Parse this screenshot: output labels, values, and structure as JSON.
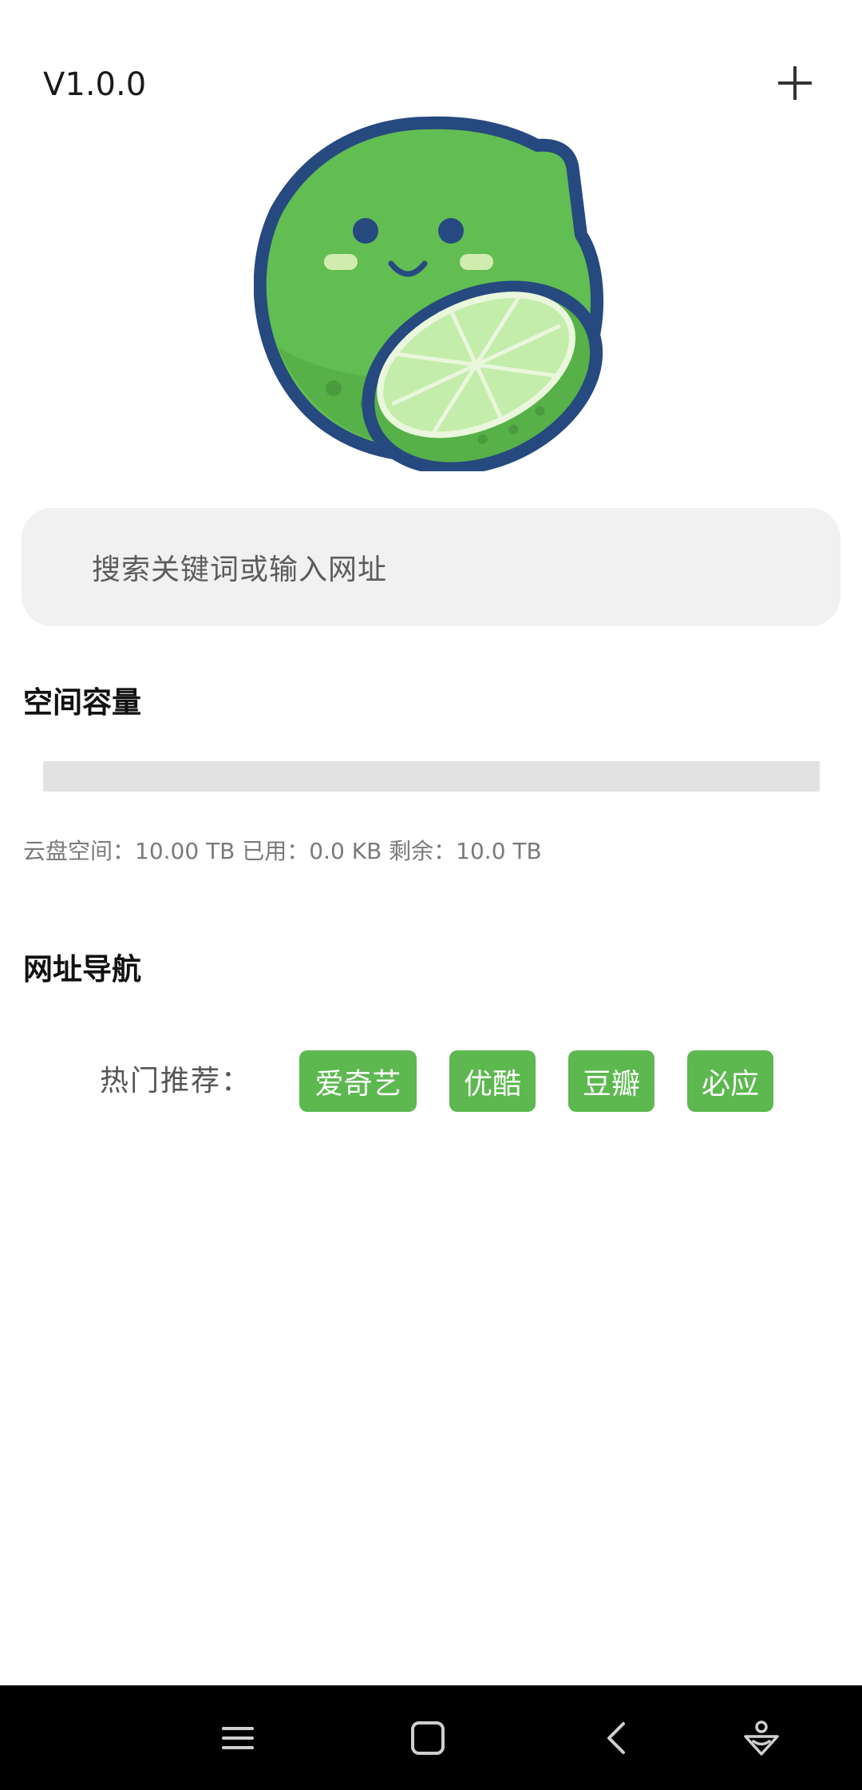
{
  "header": {
    "version": "V1.0.0",
    "add_icon": "plus-icon"
  },
  "logo": {
    "icon": "lime-mascot-logo",
    "colors": {
      "outline": "#26497f",
      "skin": "#62bd52",
      "flesh": "#c4ecab"
    }
  },
  "search": {
    "placeholder": "搜索关键词或输入网址"
  },
  "storage": {
    "title": "空间容量",
    "used_fraction": 0.0,
    "info": "云盘空间：10.00 TB  已用：0.0 KB  剩余：10.0 TB"
  },
  "navigation": {
    "title": "网址导航",
    "hot_label": "热门推荐：",
    "links": [
      {
        "label": "爱奇艺"
      },
      {
        "label": "优酷"
      },
      {
        "label": "豆瓣"
      },
      {
        "label": "必应"
      }
    ]
  },
  "system_nav": {
    "icons": [
      "menu-icon",
      "home-icon",
      "back-icon",
      "assistant-icon"
    ]
  },
  "colors": {
    "accent": "#5cb84f",
    "search_bg": "#f1f1f1",
    "progress_track": "#e2e2e2",
    "navbar_bg": "#000000"
  }
}
